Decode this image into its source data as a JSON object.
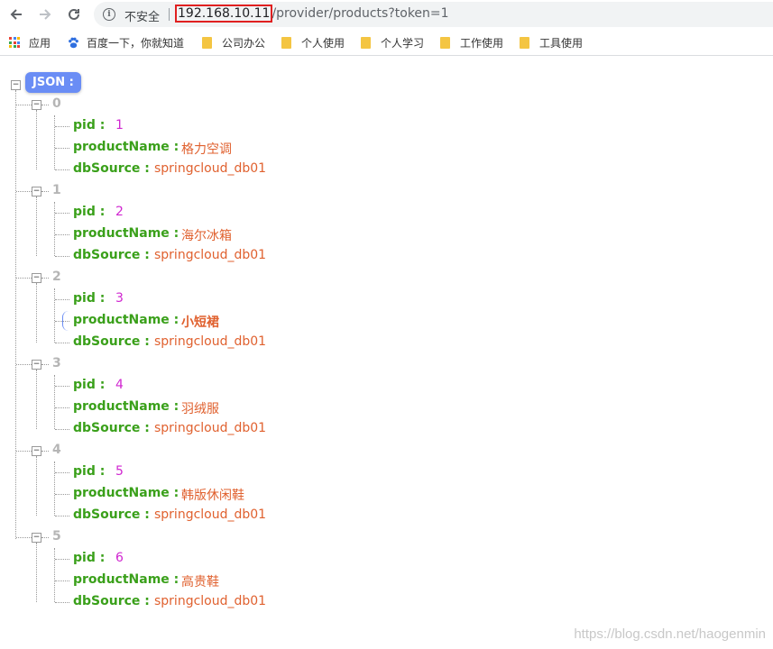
{
  "browser": {
    "security_label": "不安全",
    "url_host": "192.168.10.11",
    "url_path": "/provider/products?token=1"
  },
  "bookmarks": [
    {
      "label": "应用",
      "icon": "apps-grid-icon"
    },
    {
      "label": "百度一下，你就知道",
      "icon": "baidu-paw-icon"
    },
    {
      "label": "公司办公",
      "icon": "folder-icon"
    },
    {
      "label": "个人使用",
      "icon": "folder-icon"
    },
    {
      "label": "个人学习",
      "icon": "folder-icon"
    },
    {
      "label": "工作使用",
      "icon": "folder-icon"
    },
    {
      "label": "工具使用",
      "icon": "folder-icon"
    }
  ],
  "json_viewer": {
    "root_label": "JSON :",
    "items": [
      {
        "index": "0",
        "pid_key": "pid :",
        "pid": "1",
        "name_key": "productName :",
        "name": "格力空调",
        "db_key": "dbSource :",
        "db": "springcloud_db01"
      },
      {
        "index": "1",
        "pid_key": "pid :",
        "pid": "2",
        "name_key": "productName :",
        "name": "海尔冰箱",
        "db_key": "dbSource :",
        "db": "springcloud_db01"
      },
      {
        "index": "2",
        "pid_key": "pid :",
        "pid": "3",
        "name_key": "productName :",
        "name": "小短裙",
        "db_key": "dbSource :",
        "db": "springcloud_db01"
      },
      {
        "index": "3",
        "pid_key": "pid :",
        "pid": "4",
        "name_key": "productName :",
        "name": "羽绒服",
        "db_key": "dbSource :",
        "db": "springcloud_db01"
      },
      {
        "index": "4",
        "pid_key": "pid :",
        "pid": "5",
        "name_key": "productName :",
        "name": "韩版休闲鞋",
        "db_key": "dbSource :",
        "db": "springcloud_db01"
      },
      {
        "index": "5",
        "pid_key": "pid :",
        "pid": "6",
        "name_key": "productName :",
        "name": "高贵鞋",
        "db_key": "dbSource :",
        "db": "springcloud_db01"
      }
    ]
  },
  "watermark": "https://blog.csdn.net/haogenmin",
  "colors": {
    "key": "#3aa01a",
    "number": "#d026d0",
    "string": "#e0612f",
    "index": "#b5b5b5",
    "badge": "#6a8df5",
    "highlight": "#e02020"
  }
}
